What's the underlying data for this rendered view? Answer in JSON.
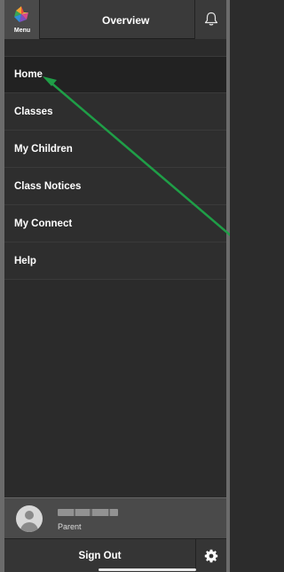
{
  "header": {
    "menu_label": "Menu",
    "title": "Overview",
    "icons": {
      "logo": "app-logo-icon",
      "bell": "bell-icon"
    }
  },
  "nav": {
    "items": [
      {
        "label": "Home",
        "active": true
      },
      {
        "label": "Classes"
      },
      {
        "label": "My Children"
      },
      {
        "label": "Class Notices"
      },
      {
        "label": "My Connect"
      },
      {
        "label": "Help"
      }
    ]
  },
  "user": {
    "role": "Parent",
    "icons": {
      "avatar": "avatar-icon"
    }
  },
  "footer": {
    "sign_out_label": "Sign Out",
    "icons": {
      "settings": "gear-icon"
    }
  },
  "colors": {
    "annotation_arrow": "#1f9e47",
    "panel": "#2e2e2e",
    "active_row": "#222222"
  }
}
